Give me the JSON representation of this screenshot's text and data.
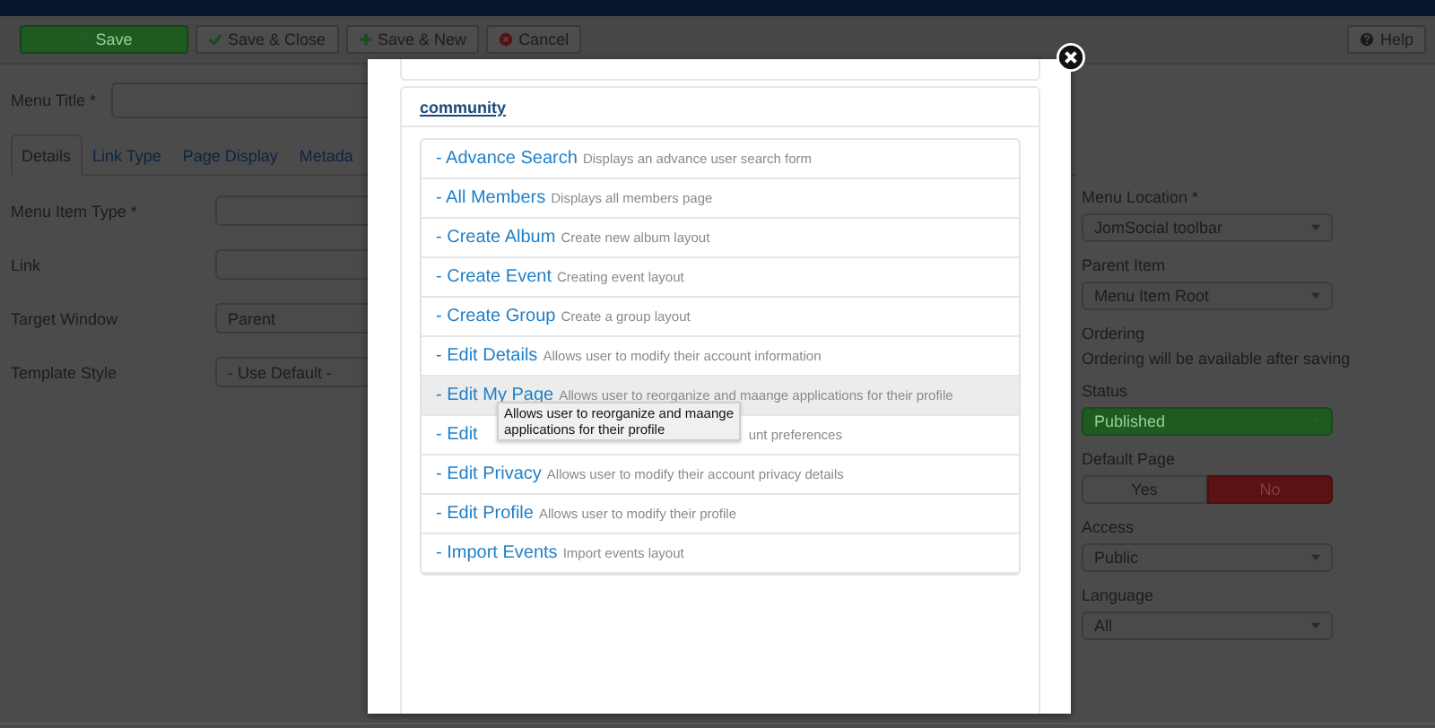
{
  "toolbar": {
    "buttons": [
      {
        "label": "Save",
        "kind": "primary"
      },
      {
        "label": "Save & Close",
        "kind": "default"
      },
      {
        "label": "Save & New",
        "kind": "default"
      },
      {
        "label": "Cancel",
        "kind": "default"
      }
    ],
    "help": {
      "label": "Help"
    }
  },
  "menu_title": {
    "label": "Menu Title *"
  },
  "tabs": [
    {
      "label": "Details",
      "selected": true
    },
    {
      "label": "Link Type",
      "selected": false
    },
    {
      "label": "Page Display",
      "selected": false
    },
    {
      "label": "Metada",
      "selected": false
    }
  ],
  "details_fields": [
    {
      "label": "Menu Item Type *",
      "kind": "input"
    },
    {
      "label": "Link",
      "kind": "input"
    },
    {
      "label": "Target Window",
      "kind": "select",
      "value": "Parent"
    },
    {
      "label": "Template Style",
      "kind": "select",
      "value": "- Use Default -"
    }
  ],
  "side_fields": [
    {
      "label": "Menu Location *",
      "kind": "select",
      "value": "JomSocial toolbar"
    },
    {
      "label": "Parent Item",
      "kind": "select",
      "value": "Menu Item Root"
    },
    {
      "label": "Ordering",
      "kind": "text",
      "value": "Ordering will be available after saving"
    },
    {
      "label": "Status",
      "kind": "status",
      "value": "Published"
    },
    {
      "label": "Default Page",
      "kind": "toggle",
      "options": [
        {
          "label": "Yes",
          "selected": false
        },
        {
          "label": "No",
          "selected": true
        }
      ]
    },
    {
      "label": "Access",
      "kind": "select",
      "value": "Public"
    },
    {
      "label": "Language",
      "kind": "select",
      "value": "All"
    }
  ],
  "modal": {
    "section_title": "community",
    "items": [
      {
        "title": "- Advance Search",
        "description": "Displays an advance user search form",
        "hovered": false
      },
      {
        "title": "- All Members",
        "description": "Displays all members page",
        "hovered": false
      },
      {
        "title": "- Create Album",
        "description": "Create new album layout",
        "hovered": false
      },
      {
        "title": "- Create Event",
        "description": "Creating event layout",
        "hovered": false
      },
      {
        "title": "- Create Group",
        "description": "Create a group layout",
        "hovered": false
      },
      {
        "title": "- Edit Details",
        "description": "Allows user to modify their account information",
        "hovered": false
      },
      {
        "title": "- Edit My Page",
        "description": "Allows user to reorganize and maange applications for their profile",
        "hovered": true,
        "tooltip": "Allows user to reorganize and maange applications for their profile"
      },
      {
        "title": "- Edit",
        "description": "unt preferences",
        "hovered": false
      },
      {
        "title": "- Edit Privacy",
        "description": "Allows user to modify their account privacy details",
        "hovered": false
      },
      {
        "title": "- Edit Profile",
        "description": "Allows user to modify their profile",
        "hovered": false
      },
      {
        "title": "- Import Events",
        "description": "Import events layout",
        "hovered": false
      }
    ]
  }
}
